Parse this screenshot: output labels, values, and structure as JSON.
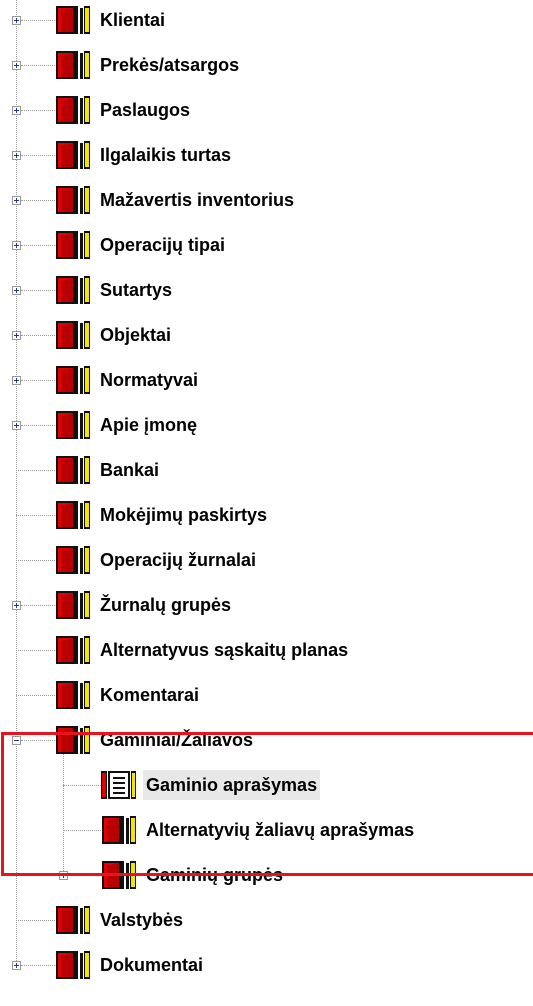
{
  "tree": {
    "items": [
      {
        "label": "Klientai",
        "level": 0,
        "expander": "plus",
        "icon": "folder-closed-icon"
      },
      {
        "label": "Prekės/atsargos",
        "level": 0,
        "expander": "plus",
        "icon": "folder-closed-icon"
      },
      {
        "label": "Paslaugos",
        "level": 0,
        "expander": "plus",
        "icon": "folder-closed-icon"
      },
      {
        "label": "Ilgalaikis turtas",
        "level": 0,
        "expander": "plus",
        "icon": "folder-closed-icon"
      },
      {
        "label": "Mažavertis inventorius",
        "level": 0,
        "expander": "plus",
        "icon": "folder-closed-icon"
      },
      {
        "label": "Operacijų tipai",
        "level": 0,
        "expander": "plus",
        "icon": "folder-closed-icon"
      },
      {
        "label": "Sutartys",
        "level": 0,
        "expander": "plus",
        "icon": "folder-closed-icon"
      },
      {
        "label": "Objektai",
        "level": 0,
        "expander": "plus",
        "icon": "folder-closed-icon"
      },
      {
        "label": "Normatyvai",
        "level": 0,
        "expander": "plus",
        "icon": "folder-closed-icon"
      },
      {
        "label": "Apie įmonę",
        "level": 0,
        "expander": "plus",
        "icon": "folder-closed-icon"
      },
      {
        "label": "Bankai",
        "level": 0,
        "expander": "none",
        "icon": "folder-closed-icon"
      },
      {
        "label": "Mokėjimų paskirtys",
        "level": 0,
        "expander": "none",
        "icon": "folder-closed-icon"
      },
      {
        "label": "Operacijų žurnalai",
        "level": 0,
        "expander": "none",
        "icon": "folder-closed-icon"
      },
      {
        "label": "Žurnalų grupės",
        "level": 0,
        "expander": "plus",
        "icon": "folder-closed-icon"
      },
      {
        "label": "Alternatyvus sąskaitų planas",
        "level": 0,
        "expander": "none",
        "icon": "folder-closed-icon"
      },
      {
        "label": "Komentarai",
        "level": 0,
        "expander": "none",
        "icon": "folder-closed-icon"
      },
      {
        "label": "Gaminiai/Žaliavos",
        "level": 0,
        "expander": "minus",
        "icon": "folder-closed-icon"
      },
      {
        "label": "Gaminio aprašymas",
        "level": 1,
        "expander": "none",
        "icon": "document-open-icon",
        "selected": true
      },
      {
        "label": "Alternatyvių žaliavų aprašymas",
        "level": 1,
        "expander": "none",
        "icon": "folder-closed-icon"
      },
      {
        "label": "Gaminių grupės",
        "level": 1,
        "expander": "plus",
        "icon": "folder-closed-icon"
      },
      {
        "label": "Valstybės",
        "level": 0,
        "expander": "none",
        "icon": "folder-closed-icon"
      },
      {
        "label": "Dokumentai",
        "level": 0,
        "expander": "plus",
        "icon": "folder-closed-icon"
      }
    ]
  },
  "highlight": {
    "color": "#e8131c"
  },
  "colors": {
    "folder_red": "#e00000",
    "folder_yellow": "#f5e400",
    "tree_line": "#9a9a9a",
    "selection_bg": "#e8e8e8"
  }
}
